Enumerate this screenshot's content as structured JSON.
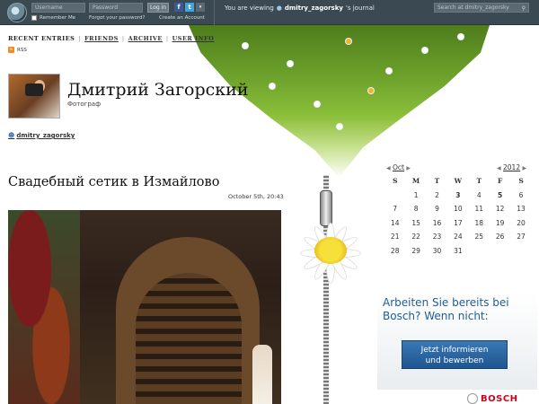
{
  "topbar": {
    "username_placeholder": "Username",
    "password_placeholder": "Password",
    "login_label": "Log in",
    "remember_label": "Remember Me",
    "forgot_label": "Forgot your password?",
    "create_label": "Create an Account",
    "viewing_prefix": "You are viewing",
    "viewing_user": "dmitry_zagorsky",
    "viewing_suffix": "'s journal",
    "search_placeholder": "Search at dmitry_zagorsky",
    "facebook_glyph": "f",
    "twitter_glyph": "t"
  },
  "nav": {
    "recent": "RECENT ENTRIES",
    "friends": "FRIENDS",
    "archive": "ARCHIVE",
    "userinfo": "USER INFO",
    "rss": "RSS"
  },
  "profile": {
    "name": "Дмитрий Загорский",
    "subtitle": "Фотограф",
    "username": "dmitry_zagorsky"
  },
  "entry": {
    "title": "Свадебный сетик в Измайлово",
    "date": "October 5th, 20:43"
  },
  "calendar": {
    "month": "Oct",
    "year": "2012",
    "weekdays": [
      "S",
      "M",
      "T",
      "W",
      "T",
      "F",
      "S"
    ],
    "weeks": [
      [
        "",
        "1",
        "2",
        "3",
        "4",
        "5",
        "6"
      ],
      [
        "7",
        "8",
        "9",
        "10",
        "11",
        "12",
        "13"
      ],
      [
        "14",
        "15",
        "16",
        "17",
        "18",
        "19",
        "20"
      ],
      [
        "21",
        "22",
        "23",
        "24",
        "25",
        "26",
        "27"
      ],
      [
        "28",
        "29",
        "30",
        "31",
        "",
        "",
        ""
      ]
    ],
    "bold_days": [
      "3",
      "5"
    ]
  },
  "ad": {
    "headline": "Arbeiten Sie bereits bei Bosch? Wenn nicht:",
    "button_line1": "Jetzt informieren",
    "button_line2": "und bewerben",
    "brand": "BOSCH"
  }
}
